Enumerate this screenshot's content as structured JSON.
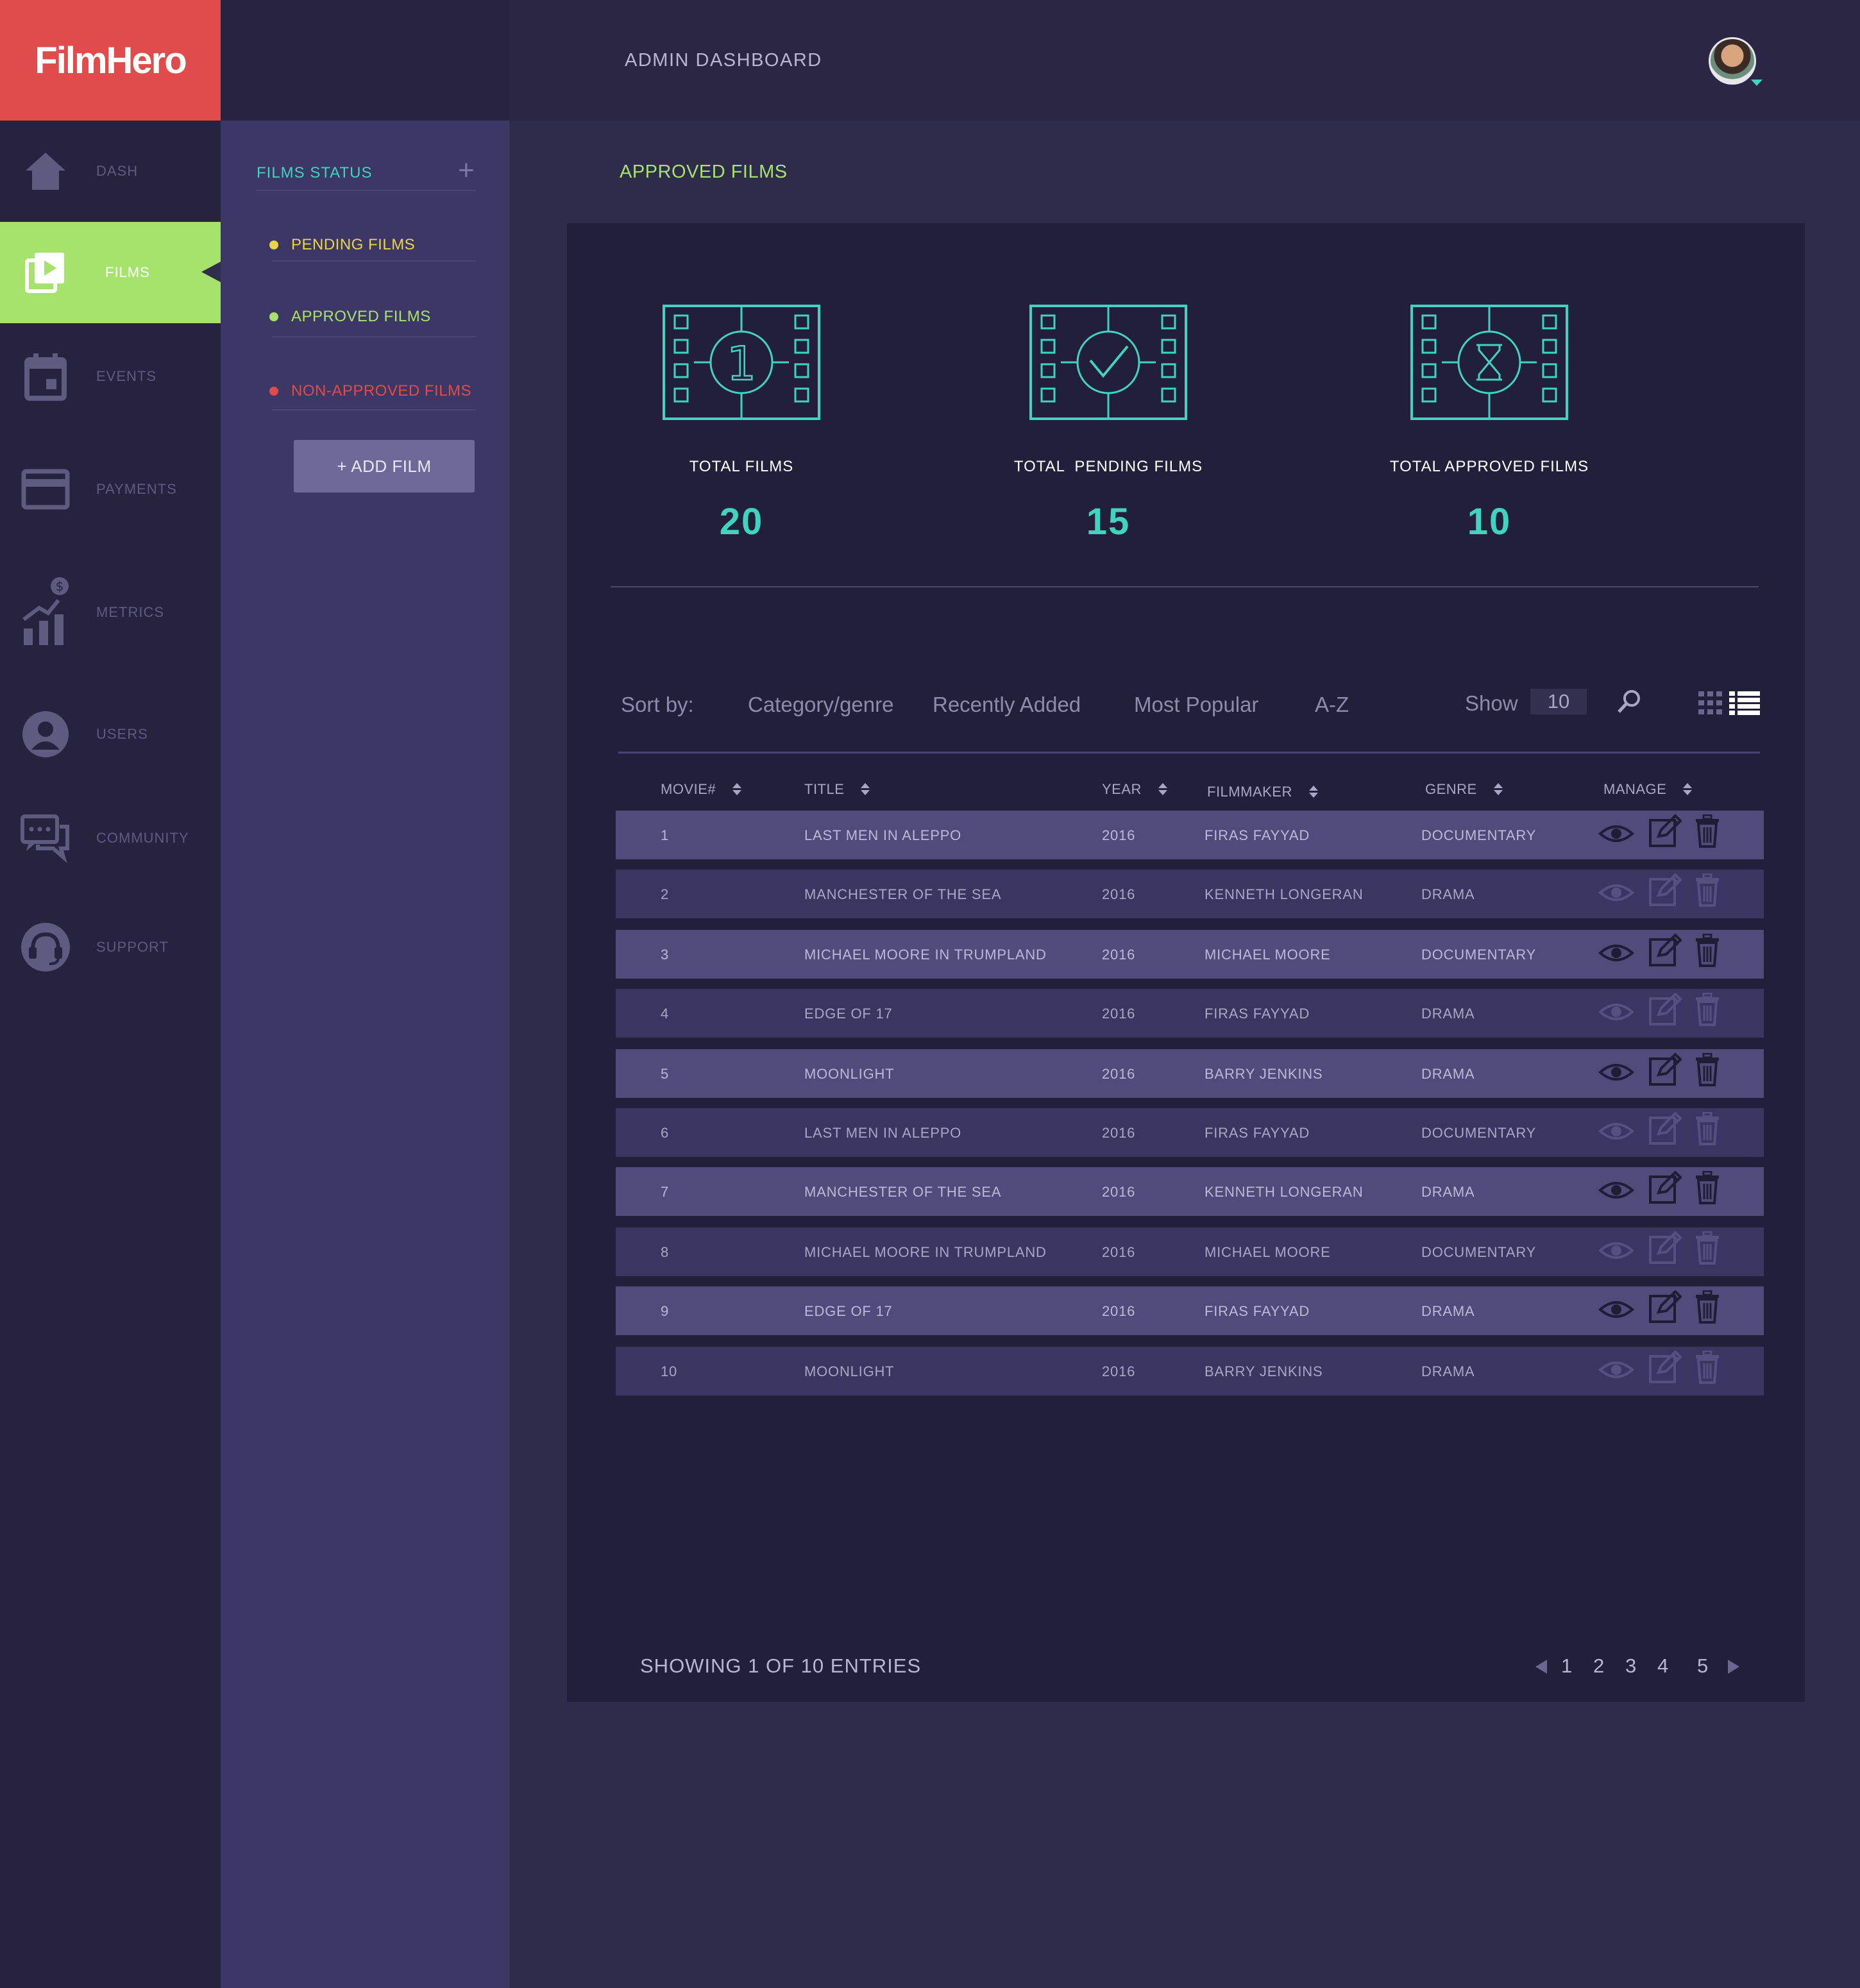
{
  "brand": {
    "name_a": "Film",
    "name_b": "Hero"
  },
  "nav": [
    {
      "label": "DASH",
      "icon": "home-icon"
    },
    {
      "label": "FILMS",
      "icon": "film-play-icon",
      "active": true
    },
    {
      "label": "EVENTS",
      "icon": "calendar-icon"
    },
    {
      "label": "PAYMENTS",
      "icon": "card-icon"
    },
    {
      "label": "METRICS",
      "icon": "metrics-icon"
    },
    {
      "label": "USERS",
      "icon": "user-icon"
    },
    {
      "label": "COMMUNITY",
      "icon": "chat-icon"
    },
    {
      "label": "SUPPORT",
      "icon": "headset-icon"
    }
  ],
  "subpanel": {
    "title": "FILMS STATUS",
    "items": [
      {
        "label": "PENDING FILMS",
        "color": "#e8d54a"
      },
      {
        "label": "APPROVED FILMS",
        "color": "#a6e36d"
      },
      {
        "label": "NON-APPROVED FILMS",
        "color": "#e04b4b"
      }
    ],
    "add_button": "+ ADD FILM"
  },
  "topbar": {
    "title": "ADMIN DASHBOARD"
  },
  "main": {
    "heading": "APPROVED FILMS",
    "stats": [
      {
        "label": "TOTAL FILMS",
        "value": "20",
        "icon": "film-one-icon"
      },
      {
        "label": "TOTAL  PENDING FILMS",
        "value": "15",
        "icon": "film-check-icon"
      },
      {
        "label": "TOTAL APPROVED FILMS",
        "value": "10",
        "icon": "film-hourglass-icon"
      }
    ],
    "sort": {
      "label": "Sort by:",
      "options": [
        "Category/genre",
        "Recently Added",
        "Most Popular",
        "A-Z"
      ],
      "show_label": "Show",
      "show_value": "10"
    },
    "table": {
      "headers": [
        "MOVIE#",
        "TITLE",
        "YEAR",
        "FILMMAKER",
        "GENRE",
        "MANAGE"
      ],
      "rows": [
        [
          "1",
          "LAST MEN IN ALEPPO",
          "2016",
          "FIRAS FAYYAD",
          "DOCUMENTARY"
        ],
        [
          "2",
          "MANCHESTER OF THE SEA",
          "2016",
          "KENNETH LONGERAN",
          "DRAMA"
        ],
        [
          "3",
          "MICHAEL MOORE IN TRUMPLAND",
          "2016",
          "MICHAEL MOORE",
          "DOCUMENTARY"
        ],
        [
          "4",
          "EDGE OF 17",
          "2016",
          "FIRAS FAYYAD",
          "DRAMA"
        ],
        [
          "5",
          "MOONLIGHT",
          "2016",
          "BARRY JENKINS",
          "DRAMA"
        ],
        [
          "6",
          "LAST MEN IN ALEPPO",
          "2016",
          "FIRAS FAYYAD",
          "DOCUMENTARY"
        ],
        [
          "7",
          "MANCHESTER OF THE SEA",
          "2016",
          "KENNETH LONGERAN",
          "DRAMA"
        ],
        [
          "8",
          "MICHAEL MOORE IN TRUMPLAND",
          "2016",
          "MICHAEL MOORE",
          "DOCUMENTARY"
        ],
        [
          "9",
          "EDGE OF 17",
          "2016",
          "FIRAS FAYYAD",
          "DRAMA"
        ],
        [
          "10",
          "MOONLIGHT",
          "2016",
          "BARRY JENKINS",
          "DRAMA"
        ]
      ]
    },
    "showing": "SHOWING 1 OF 10 ENTRIES",
    "pages": [
      "1",
      "2",
      "3",
      "4",
      "5"
    ]
  },
  "colors": {
    "accent_teal": "#3fd3c0",
    "accent_green": "#a6e36d",
    "brand_red": "#e04b4b"
  }
}
